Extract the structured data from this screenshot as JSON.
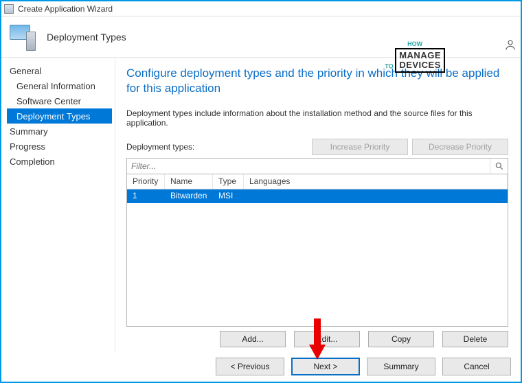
{
  "window": {
    "title": "Create Application Wizard"
  },
  "header": {
    "title": "Deployment Types",
    "watermark_how": "HOW\nTO",
    "watermark_box_top": "MANAGE",
    "watermark_box_bottom": "DEVICES"
  },
  "sidebar": {
    "items": [
      {
        "label": "General",
        "sub": false,
        "active": false
      },
      {
        "label": "General Information",
        "sub": true,
        "active": false
      },
      {
        "label": "Software Center",
        "sub": true,
        "active": false
      },
      {
        "label": "Deployment Types",
        "sub": true,
        "active": true
      },
      {
        "label": "Summary",
        "sub": false,
        "active": false
      },
      {
        "label": "Progress",
        "sub": false,
        "active": false
      },
      {
        "label": "Completion",
        "sub": false,
        "active": false
      }
    ]
  },
  "content": {
    "heading": "Configure deployment types and the priority in which they will be applied for this application",
    "description": "Deployment types include information about the installation method and the source files for this application.",
    "dt_label": "Deployment types:",
    "increase_label": "Increase Priority",
    "decrease_label": "Decrease Priority",
    "filter_placeholder": "Filter...",
    "columns": {
      "priority": "Priority",
      "name": "Name",
      "type": "Type",
      "languages": "Languages"
    },
    "rows": [
      {
        "priority": "1",
        "name": "Bitwarden",
        "type": "MSI",
        "languages": ""
      }
    ],
    "buttons": {
      "add": "Add...",
      "edit": "Edit...",
      "copy": "Copy",
      "delete": "Delete"
    }
  },
  "footer": {
    "previous": "< Previous",
    "next": "Next >",
    "summary": "Summary",
    "cancel": "Cancel"
  }
}
